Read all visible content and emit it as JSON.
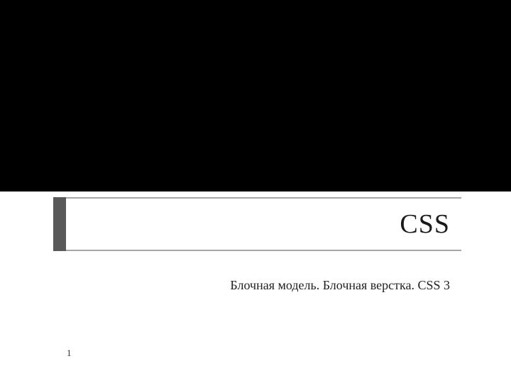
{
  "slide": {
    "title": "CSS",
    "subtitle": "Блочная модель. Блочная верстка. CSS 3",
    "page_number": "1"
  }
}
